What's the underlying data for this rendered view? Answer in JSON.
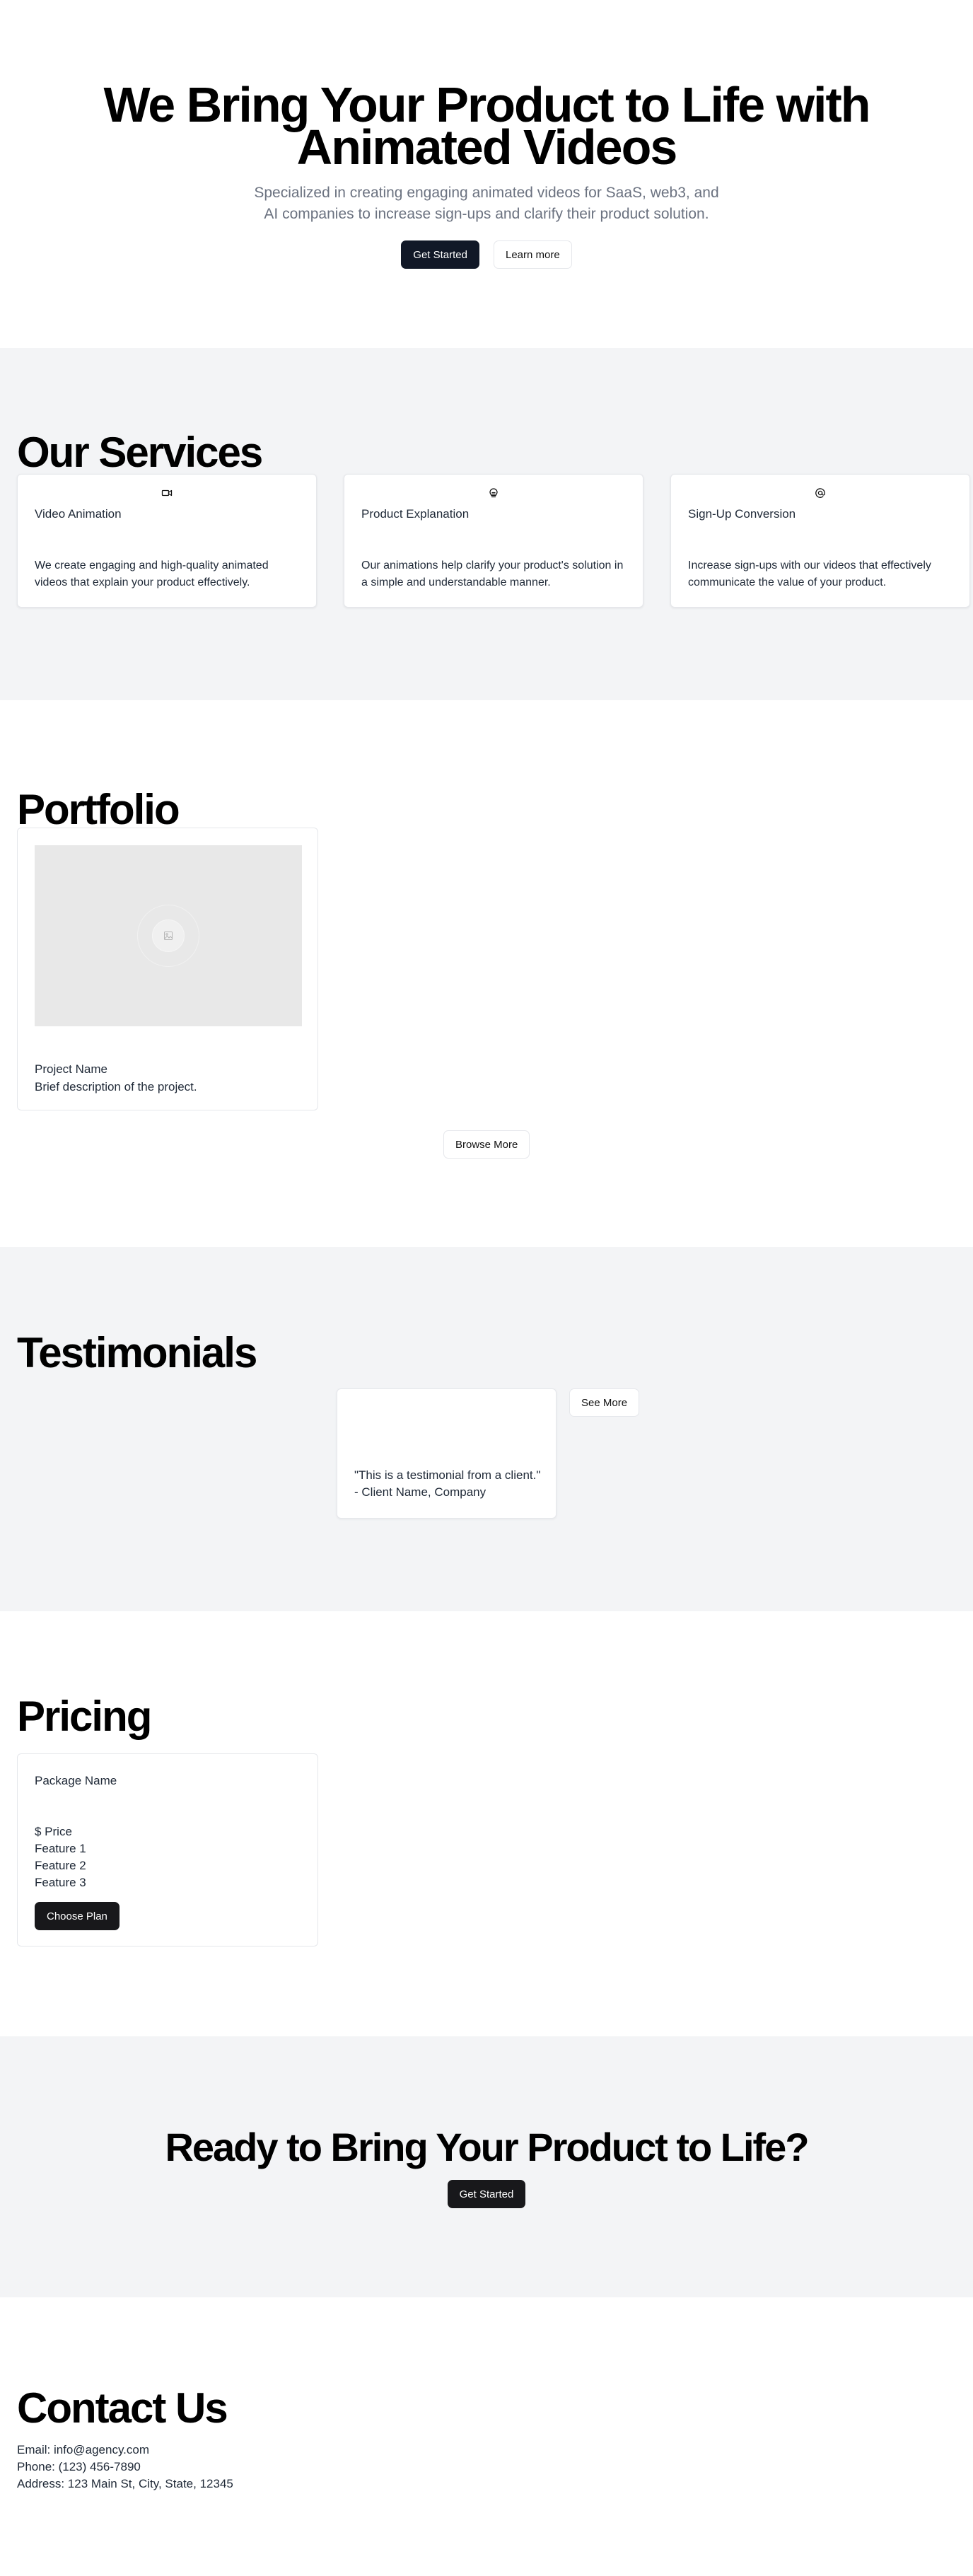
{
  "hero": {
    "title": "We Bring Your Product to Life with Animated Videos",
    "subtitle": "Specialized in creating engaging animated videos for SaaS, web3, and AI companies to increase sign-ups and clarify their product solution.",
    "primary_label": "Get Started",
    "secondary_label": "Learn more"
  },
  "services": {
    "heading": "Our Services",
    "items": [
      {
        "icon": "video-camera-icon",
        "title": "Video Animation",
        "description": "We create engaging and high-quality animated videos that explain your product effectively."
      },
      {
        "icon": "lightbulb-icon",
        "title": "Product Explanation",
        "description": "Our animations help clarify your product's solution in a simple and understandable manner."
      },
      {
        "icon": "at-sign-icon",
        "title": "Sign-Up Conversion",
        "description": "Increase sign-ups with our videos that effectively communicate the value of your product."
      }
    ]
  },
  "portfolio": {
    "heading": "Portfolio",
    "items": [
      {
        "name": "Project Name",
        "description": "Brief description of the project.",
        "image_icon": "image-placeholder-icon"
      }
    ],
    "browse_label": "Browse More"
  },
  "testimonials": {
    "heading": "Testimonials",
    "items": [
      {
        "quote": "\"This is a testimonial from a client.\"",
        "client": "- Client Name, Company"
      }
    ],
    "see_more_label": "See More"
  },
  "pricing": {
    "heading": "Pricing",
    "packages": [
      {
        "name": "Package Name",
        "price": "$ Price",
        "features": [
          "Feature 1",
          "Feature 2",
          "Feature 3"
        ],
        "button_label": "Choose Plan"
      }
    ]
  },
  "cta": {
    "heading": "Ready to Bring Your Product to Life?",
    "button_label": "Get Started"
  },
  "contact": {
    "heading": "Contact Us",
    "email": "Email: info@agency.com",
    "phone": "Phone: (123) 456-7890",
    "address": "Address: 123 Main St, City, State, 12345"
  },
  "colors": {
    "primary_button": "#111827",
    "section_gray": "#f3f4f6",
    "muted_text": "#6b7280"
  }
}
